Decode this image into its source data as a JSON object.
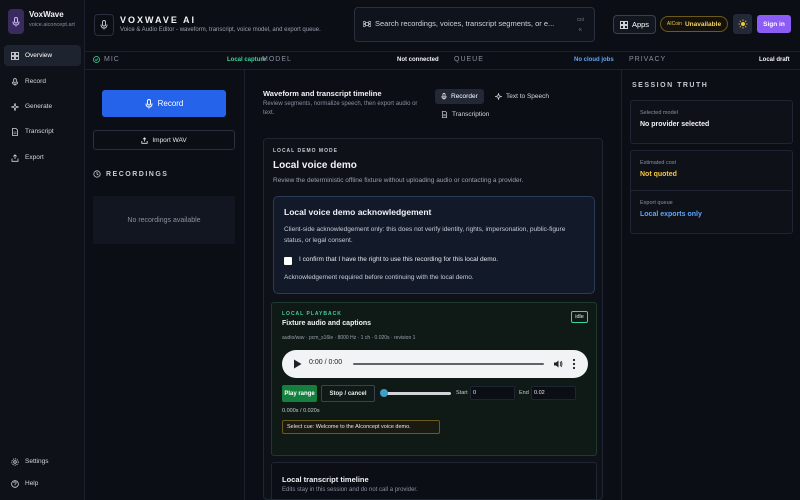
{
  "brand": {
    "name": "VoxWave",
    "url": "voice.aiconcept.art"
  },
  "nav": {
    "items": [
      {
        "label": "Overview",
        "icon": "grid-icon"
      },
      {
        "label": "Record",
        "icon": "mic-icon"
      },
      {
        "label": "Generate",
        "icon": "sparkle-icon"
      },
      {
        "label": "Transcript",
        "icon": "document-icon"
      },
      {
        "label": "Export",
        "icon": "export-icon"
      }
    ],
    "bottom": [
      {
        "label": "Settings",
        "icon": "gear-icon"
      },
      {
        "label": "Help",
        "icon": "help-icon"
      }
    ]
  },
  "header": {
    "title": "VOXWAVE AI",
    "subtitle": "Voice & Audio Editor - waveform, transcript, voice model, and export queue.",
    "search_placeholder": "Search recordings, voices, transcript segments, or e...",
    "shortcut_top": "Ctrl",
    "shortcut_bottom": "K",
    "apps_label": "Apps",
    "credit_prefix": "AICoin",
    "credit_status": "Unavailable",
    "signin_label": "Sign in"
  },
  "status": {
    "mic_label": "MIC",
    "mic_value": "Local capture",
    "model_label": "MODEL",
    "model_value": "Not connected",
    "queue_label": "QUEUE",
    "queue_value": "No cloud jobs",
    "privacy_label": "PRIVACY",
    "privacy_value": "Local draft"
  },
  "left": {
    "record_label": "Record",
    "import_label": "Import WAV",
    "recordings_heading": "RECORDINGS",
    "recordings_empty": "No recordings available"
  },
  "main": {
    "title": "Waveform and transcript timeline",
    "subtitle": "Review segments, normalize speech, then export audio or text.",
    "tabs": [
      {
        "label": "Recorder"
      },
      {
        "label": "Text to Speech"
      },
      {
        "label": "Transcription"
      }
    ],
    "demo": {
      "mode_tag": "LOCAL DEMO MODE",
      "title": "Local voice demo",
      "subtitle": "Review the deterministic offline fixture without uploading audio or contacting a provider.",
      "ack_title": "Local voice demo acknowledgement",
      "ack_body": "Client-side acknowledgement only: this does not verify identity, rights, impersonation, public-figure status, or legal consent.",
      "ack_check_label": "I confirm that I have the right to use this recording for this local demo.",
      "ack_note": "Acknowledgement required before continuing with the local demo."
    },
    "playback": {
      "tag": "LOCAL PLAYBACK",
      "title": "Fixture audio and captions",
      "state": "idle",
      "meta": "audio/wav · pcm_s16le · 8000 Hz · 1 ch · 0.020s · revision 1",
      "player_time": "0:00 / 0:00",
      "play_range_label": "Play range",
      "stop_label": "Stop / cancel",
      "start_label": "Start",
      "start_value": "0",
      "end_label": "End",
      "end_value": "0.02",
      "range_readout": "0.000s / 0.020s",
      "cue": "Select cue: Welcome to the AIconcept voice demo."
    },
    "timeline": {
      "title": "Local transcript timeline",
      "subtitle": "Edits stay in this session and do not call a provider."
    }
  },
  "session": {
    "heading": "SESSION TRUTH",
    "cards": [
      {
        "label": "Selected model",
        "value": "No provider selected",
        "color": "#f1f2f6"
      },
      {
        "label": "Estimated cost",
        "value": "Not quoted",
        "color": "#f4c542"
      },
      {
        "label": "Export queue",
        "value": "Local exports only",
        "color": "#60a5fa"
      }
    ]
  },
  "colors": {
    "accent": "#2563eb",
    "signin": "#8b5cf6",
    "success": "#3fd39a",
    "warning": "#f4c542",
    "info": "#60a5fa"
  }
}
